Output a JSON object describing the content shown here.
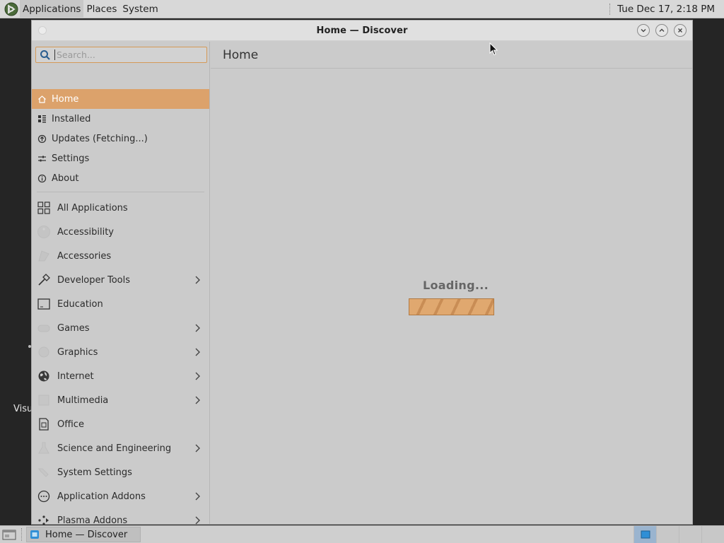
{
  "top_panel": {
    "menus": [
      "Applications",
      "Places",
      "System"
    ],
    "clock": "Tue Dec 17,  2:18 PM"
  },
  "desktop": {
    "partial_label": "Visu"
  },
  "window": {
    "title": "Home — Discover",
    "search": {
      "placeholder": "Search...",
      "value": ""
    },
    "nav": [
      {
        "label": "Home",
        "icon": "home-icon",
        "selected": true
      },
      {
        "label": "Installed",
        "icon": "installed-icon"
      },
      {
        "label": "Updates (Fetching...)",
        "icon": "updates-icon"
      },
      {
        "label": "Settings",
        "icon": "settings-icon"
      },
      {
        "label": "About",
        "icon": "info-icon"
      }
    ],
    "categories": [
      {
        "label": "All Applications",
        "icon": "grid-icon",
        "submenu": false
      },
      {
        "label": "Accessibility",
        "icon": "accessibility-icon",
        "submenu": false
      },
      {
        "label": "Accessories",
        "icon": "accessories-icon",
        "submenu": false
      },
      {
        "label": "Developer Tools",
        "icon": "hammer-icon",
        "submenu": true
      },
      {
        "label": "Education",
        "icon": "education-icon",
        "submenu": false
      },
      {
        "label": "Games",
        "icon": "games-icon",
        "submenu": true
      },
      {
        "label": "Graphics",
        "icon": "graphics-icon",
        "submenu": true
      },
      {
        "label": "Internet",
        "icon": "globe-icon",
        "submenu": true
      },
      {
        "label": "Multimedia",
        "icon": "multimedia-icon",
        "submenu": true
      },
      {
        "label": "Office",
        "icon": "office-icon",
        "submenu": false
      },
      {
        "label": "Science and Engineering",
        "icon": "science-icon",
        "submenu": true
      },
      {
        "label": "System Settings",
        "icon": "system-settings-icon",
        "submenu": false
      },
      {
        "label": "Application Addons",
        "icon": "addons-icon",
        "submenu": true
      },
      {
        "label": "Plasma Addons",
        "icon": "plasma-icon",
        "submenu": true
      }
    ],
    "main": {
      "page_title": "Home",
      "loading_text": "Loading..."
    }
  },
  "taskbar": {
    "task_label": "Home — Discover"
  },
  "colors": {
    "accent": "#dca26b",
    "progress": "#e0a86f"
  }
}
